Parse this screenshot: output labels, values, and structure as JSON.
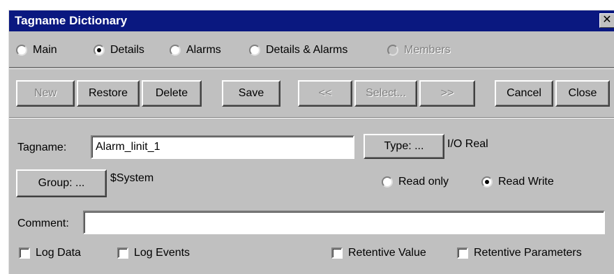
{
  "window": {
    "title": "Tagname Dictionary",
    "close_glyph": "✕"
  },
  "view_options": [
    {
      "label": "Main",
      "checked": false,
      "disabled": false
    },
    {
      "label": "Details",
      "checked": true,
      "disabled": false
    },
    {
      "label": "Alarms",
      "checked": false,
      "disabled": false
    },
    {
      "label": "Details & Alarms",
      "checked": false,
      "disabled": false
    },
    {
      "label": "Members",
      "checked": false,
      "disabled": true
    }
  ],
  "toolbar": {
    "new_label": "New",
    "restore_label": "Restore",
    "delete_label": "Delete",
    "save_label": "Save",
    "prev_label": "<<",
    "select_label": "Select...",
    "next_label": ">>",
    "cancel_label": "Cancel",
    "close_label": "Close"
  },
  "form": {
    "tagname_label": "Tagname:",
    "tagname_value": "Alarm_linit_1",
    "type_button": "Type: ...",
    "type_value": "I/O Real",
    "group_button": "Group: ...",
    "group_value": "$System",
    "access_options": [
      {
        "label": "Read only",
        "checked": false
      },
      {
        "label": "Read Write",
        "checked": true
      }
    ],
    "comment_label": "Comment:",
    "comment_value": "",
    "checkboxes": {
      "log_data": "Log Data",
      "log_events": "Log Events",
      "retentive_value": "Retentive Value",
      "retentive_parameters": "Retentive Parameters"
    }
  }
}
